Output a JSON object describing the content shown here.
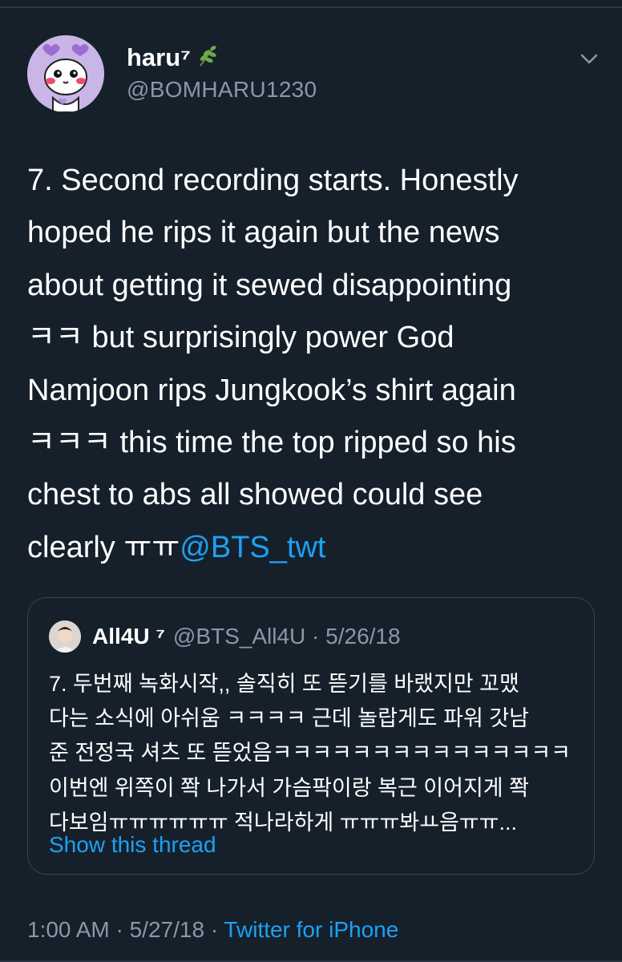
{
  "author": {
    "display_name": "haru⁷",
    "handle": "@BOMHARU1230",
    "badge_icon": "herb-leaf-icon"
  },
  "tweet": {
    "text_before": "7. Second recording starts. Honestly\nhoped he rips it again but the news\nabout getting it sewed disappointing\nㅋㅋ but surprisingly power God\nNamjoon rips Jungkook’s shirt again\nㅋㅋㅋ this time the top ripped so his\nchest to abs all showed could see\nclearly ㅠㅠ",
    "mention": "@BTS_twt"
  },
  "quoted_tweet": {
    "display_name": "All4U ⁷",
    "handle_and_date": "@BTS_All4U · 5/26/18",
    "text": "7. 두번째 녹화시작,, 솔직히 또 뜯기를 바랬지만 꼬맸\n다는 소식에 아쉬움 ㅋㅋㅋㅋ 근데 놀랍게도 파워 갓남\n준 전정국 셔츠 또 뜯었음ㅋㅋㅋㅋㅋㅋㅋㅋㅋㅋㅋㅋㅋㅋㅋ\n이번엔 위쪽이 쫙 나가서 가슴팍이랑 복근 이어지게 쫙\n다보임ㅠㅠㅠㅠㅠㅠ 적나라하게 ㅠㅠㅠ봐ㅛ음ㅠㅠ...",
    "show_thread": "Show this thread"
  },
  "footer": {
    "time_date": "1:00 AM · 5/27/18 · ",
    "source": "Twitter for iPhone"
  },
  "colors": {
    "background": "#15202b",
    "text": "#ffffff",
    "secondary": "#8899a6",
    "link": "#1da1f2",
    "border": "#38444d"
  }
}
